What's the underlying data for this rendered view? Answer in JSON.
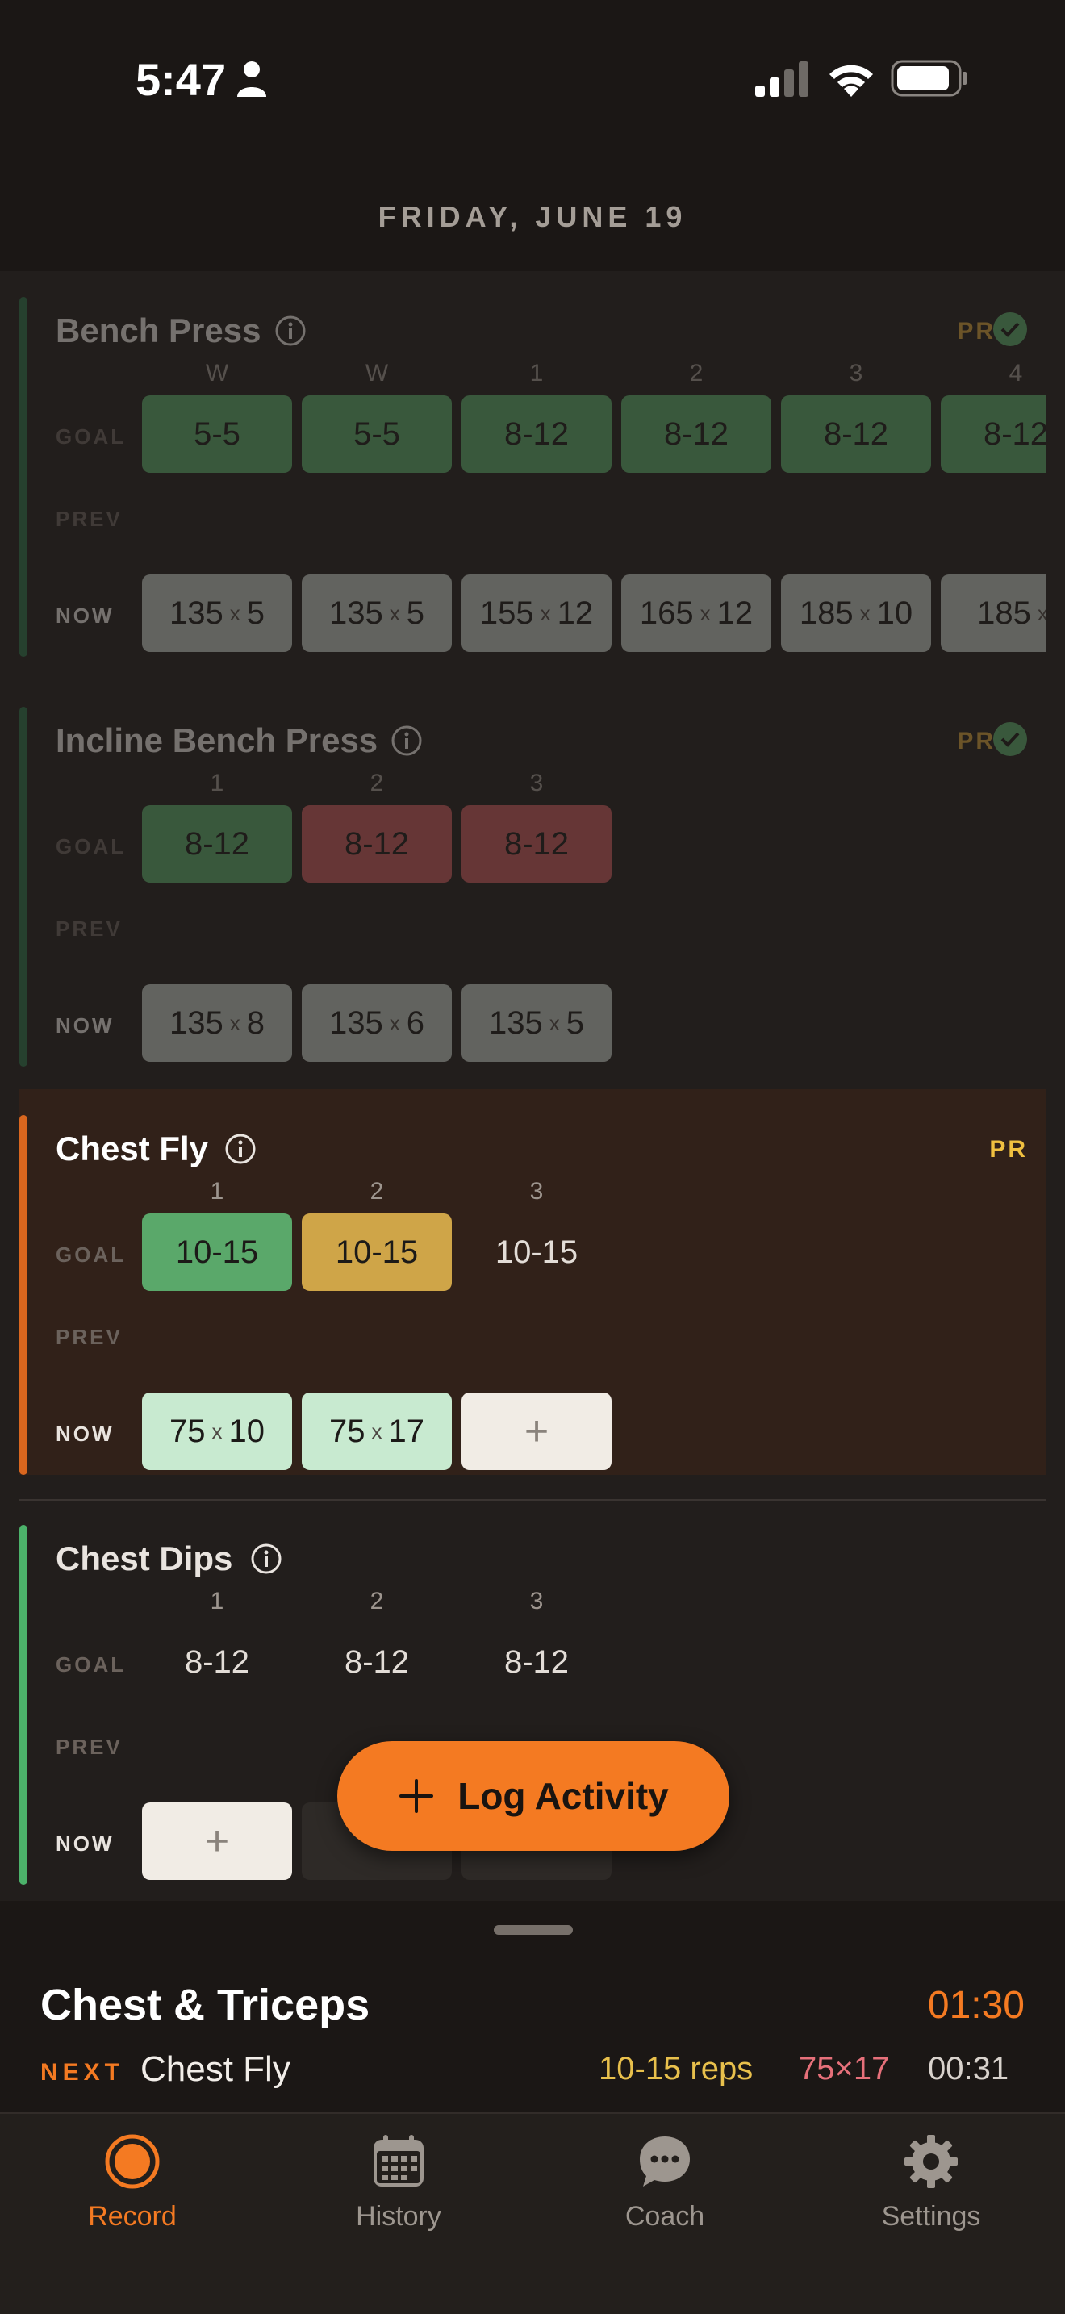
{
  "status_bar": {
    "time": "5:47"
  },
  "date": "FRIDAY, JUNE 19",
  "row_labels": {
    "goal": "GOAL",
    "prev": "PREV",
    "now": "NOW"
  },
  "exercises": [
    {
      "name": "Bench Press",
      "pr": "PR",
      "pr_checked": true,
      "sets": [
        {
          "label": "W",
          "goal": "5-5",
          "weight": "135",
          "reps": "5"
        },
        {
          "label": "W",
          "goal": "5-5",
          "weight": "135",
          "reps": "5"
        },
        {
          "label": "1",
          "goal": "8-12",
          "weight": "155",
          "reps": "12"
        },
        {
          "label": "2",
          "goal": "8-12",
          "weight": "165",
          "reps": "12"
        },
        {
          "label": "3",
          "goal": "8-12",
          "weight": "185",
          "reps": "10"
        },
        {
          "label": "4",
          "goal": "8-12",
          "weight": "185",
          "reps": "x"
        }
      ]
    },
    {
      "name": "Incline Bench Press",
      "pr": "PR",
      "pr_checked": true,
      "sets": [
        {
          "label": "1",
          "goal": "8-12",
          "goal_status": "met",
          "weight": "135",
          "reps": "8"
        },
        {
          "label": "2",
          "goal": "8-12",
          "goal_status": "missed",
          "weight": "135",
          "reps": "6"
        },
        {
          "label": "3",
          "goal": "8-12",
          "goal_status": "missed",
          "weight": "135",
          "reps": "5"
        }
      ]
    },
    {
      "name": "Chest Fly",
      "pr": "PR",
      "pr_checked": false,
      "active": true,
      "sets": [
        {
          "label": "1",
          "goal": "10-15",
          "goal_status": "met",
          "weight": "75",
          "reps": "10"
        },
        {
          "label": "2",
          "goal": "10-15",
          "goal_status": "over",
          "weight": "75",
          "reps": "17"
        },
        {
          "label": "3",
          "goal": "10-15",
          "goal_status": "pending",
          "add": "+"
        }
      ]
    },
    {
      "name": "Chest Dips",
      "sets": [
        {
          "label": "1",
          "goal": "8-12",
          "add": "+"
        },
        {
          "label": "2",
          "goal": "8-12"
        },
        {
          "label": "3",
          "goal": "8-12"
        }
      ]
    }
  ],
  "x_separator": "x",
  "fab": {
    "label": "Log Activity",
    "icon": "plus-icon"
  },
  "panel": {
    "workout": "Chest & Triceps",
    "timer": "01:30",
    "next_tag": "NEXT",
    "next_exercise": "Chest Fly",
    "next_reps": "10-15 reps",
    "next_last": "75×17",
    "next_rest": "00:31"
  },
  "tabs": [
    {
      "label": "Record",
      "icon": "record-icon",
      "active": true
    },
    {
      "label": "History",
      "icon": "calendar-icon"
    },
    {
      "label": "Coach",
      "icon": "chat-bubble-icon"
    },
    {
      "label": "Settings",
      "icon": "gear-icon"
    }
  ],
  "colors": {
    "accent": "#f47a22",
    "goal_met": "#5aa86a",
    "goal_over": "#cfa548",
    "goal_missed": "#c4585a",
    "done_set": "#c8ead0",
    "pr": "#d2a03a"
  }
}
